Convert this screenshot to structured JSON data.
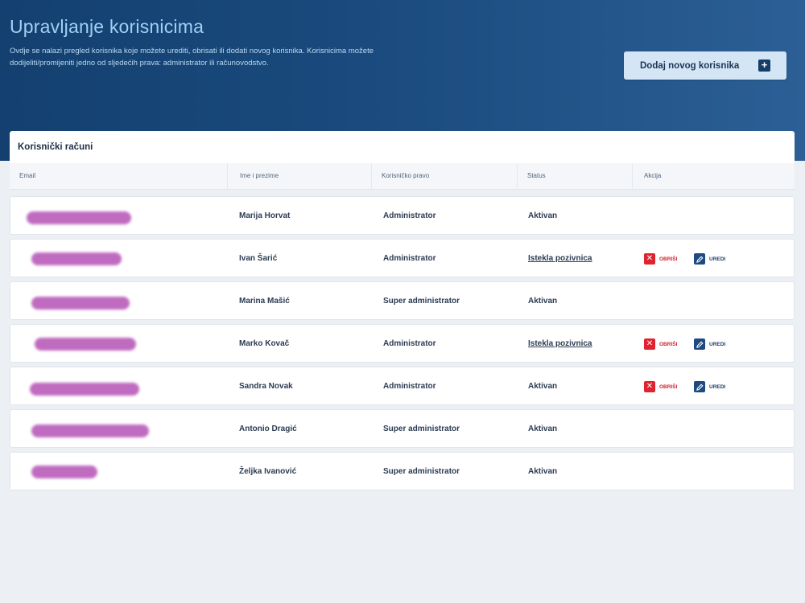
{
  "header": {
    "title": "Upravljanje korisnicima",
    "description": "Ovdje se nalazi pregled korisnika koje možete urediti, obrisati ili dodati novog korisnika. Korisnicima možete dodijeliti/promijeniti jedno od sljedećih prava: administrator ili računovodstvo.",
    "add_button_label": "Dodaj novog korisnika",
    "add_button_icon": "plus-icon"
  },
  "card": {
    "title": "Korisnički računi",
    "columns": {
      "email": "Email",
      "name": "Ime i prezime",
      "role": "Korisničko pravo",
      "status": "Status",
      "action": "Akcija"
    }
  },
  "actions": {
    "delete_label": "OBRIŠI",
    "edit_label": "UREDI",
    "delete_icon": "close-icon",
    "edit_icon": "pencil-icon"
  },
  "users": [
    {
      "name": "Marija Horvat",
      "role": "Administrator",
      "status": "Aktivan"
    },
    {
      "name": "Ivan Šarić",
      "role": "Administrator",
      "status": "Istekla pozivnica"
    },
    {
      "name": "Marina Mašić",
      "role": "Super administrator",
      "status": "Aktivan"
    },
    {
      "name": "Marko Kovač",
      "role": "Administrator",
      "status": "Istekla pozivnica"
    },
    {
      "name": "Sandra Novak",
      "role": "Administrator",
      "status": "Aktivan"
    },
    {
      "name": "Antonio Dragić",
      "role": "Super administrator",
      "status": "Aktivan"
    },
    {
      "name": "Željka Ivanović",
      "role": "Super administrator",
      "status": "Aktivan"
    }
  ],
  "colors": {
    "header_bg": "#13406f",
    "title": "#9fd1f4",
    "delete": "#e0242f",
    "edit": "#1e4a80",
    "redaction": "#b95bb9"
  }
}
